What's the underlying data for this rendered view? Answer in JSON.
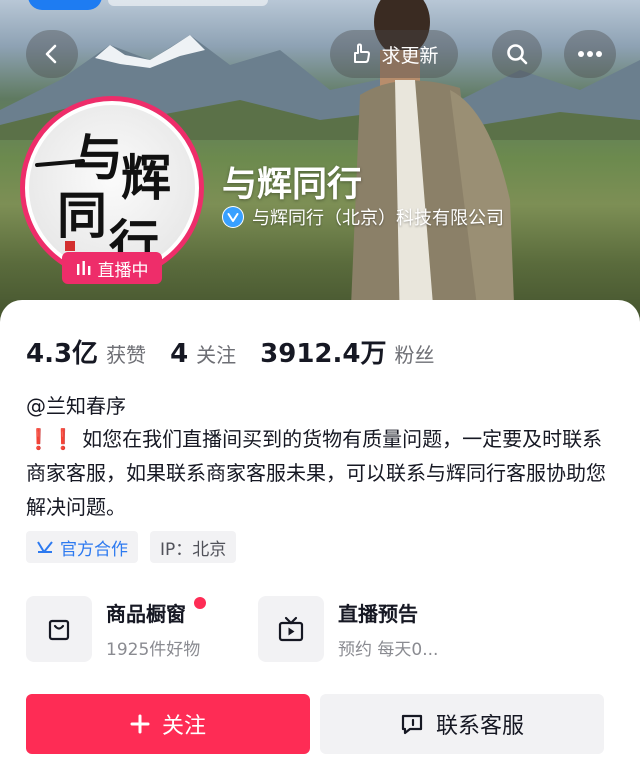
{
  "header": {
    "refresh_label": "求更新",
    "back_icon": "chevron-left-icon",
    "search_icon": "search-icon",
    "more_icon": "ellipsis-icon"
  },
  "profile": {
    "avatar_text": "与辉同行",
    "live_badge": "直播中",
    "name": "与辉同行",
    "verified_org": "与辉同行（北京）科技有限公司"
  },
  "stats": [
    {
      "value": "4.3亿",
      "label": "获赞"
    },
    {
      "value": "4",
      "label": "关注"
    },
    {
      "value": "3912.4万",
      "label": "粉丝"
    }
  ],
  "bio": {
    "handle": "@兰知春序",
    "marks": "❗❗",
    "text": "如您在我们直播间买到的货物有质量问题，一定要及时联系商家客服，如果联系商家客服未果，可以联系与辉同行客服协助您解决问题。"
  },
  "tags": {
    "official": "官方合作",
    "ip": "IP：北京"
  },
  "shelves": {
    "shop_title": "商品橱窗",
    "shop_sub": "1925件好物",
    "live_title": "直播预告",
    "live_sub": "预约 每天0..."
  },
  "actions": {
    "follow": "关注",
    "contact": "联系客服"
  },
  "colors": {
    "accent": "#fe2c55",
    "live_ring": "#ee2d6a",
    "official_blue": "#2d7af0"
  }
}
